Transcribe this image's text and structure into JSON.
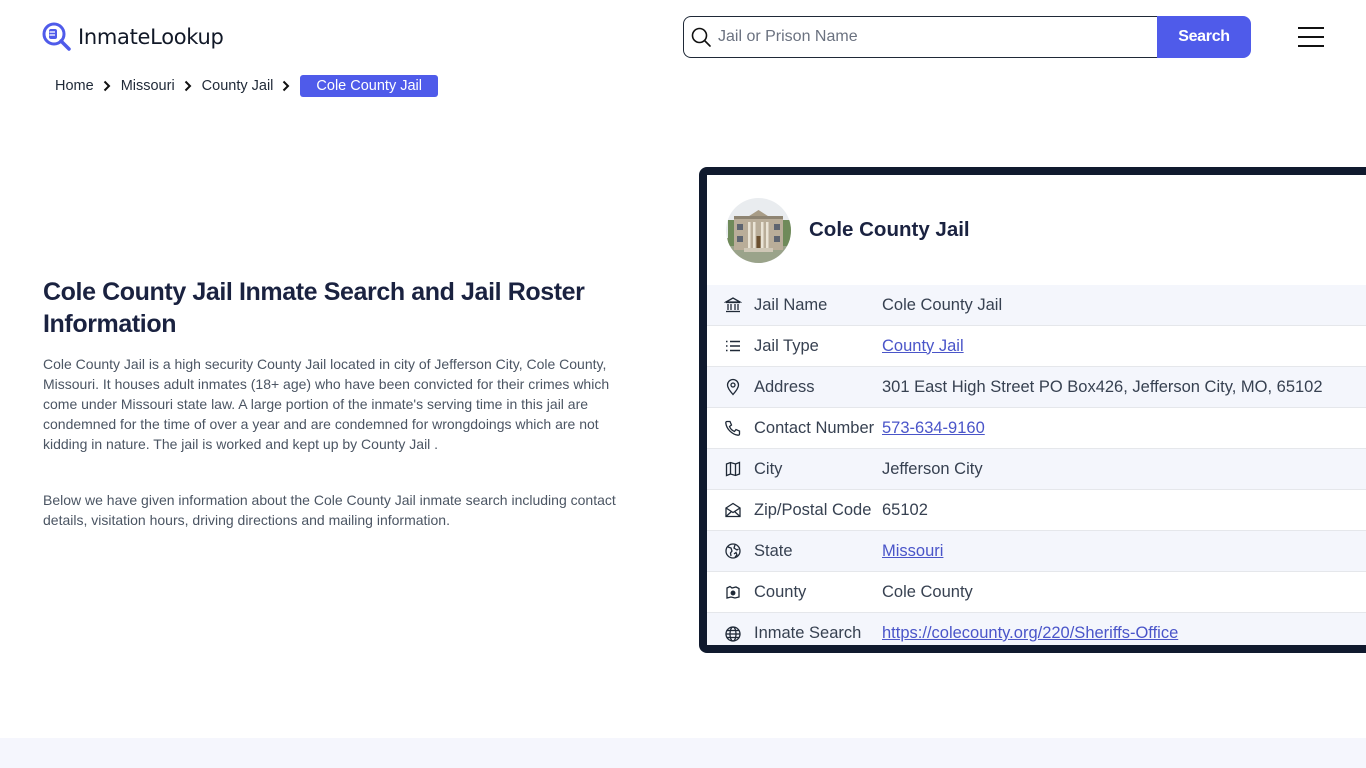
{
  "header": {
    "logo_text": "InmateLookup",
    "search": {
      "placeholder": "Jail or Prison Name",
      "value": "",
      "button_label": "Search"
    },
    "menu_icon": "hamburger-menu-icon"
  },
  "breadcrumb": {
    "items": [
      "Home",
      "Missouri",
      "County Jail"
    ],
    "current": "Cole County Jail"
  },
  "main": {
    "title": "Cole County Jail Inmate Search and Jail Roster Information",
    "paragraphs": [
      "Cole County Jail is a high security County Jail located in city of Jefferson City, Cole County, Missouri. It houses adult inmates (18+ age) who have been convicted for their crimes which come under Missouri state law. A large portion of the inmate's serving time in this jail are condemned for the time of over a year and are condemned for wrongdoings which are not kidding in nature. The jail is worked and kept up by County Jail .",
      "Below we have given information about the Cole County Jail inmate search including contact details, visitation hours, driving directions and mailing information."
    ]
  },
  "card": {
    "title": "Cole County Jail",
    "rows": [
      {
        "icon": "building-columns-icon",
        "label": "Jail Name",
        "value": "Cole County Jail",
        "link": false
      },
      {
        "icon": "list-icon",
        "label": "Jail Type",
        "value": "County Jail",
        "link": true
      },
      {
        "icon": "map-pin-icon",
        "label": "Address",
        "value": "301 East High Street PO Box426, Jefferson City, MO, 65102",
        "link": false
      },
      {
        "icon": "phone-icon",
        "label": "Contact Number",
        "value": "573-634-9160",
        "link": true
      },
      {
        "icon": "map-icon",
        "label": "City",
        "value": "Jefferson City",
        "link": false
      },
      {
        "icon": "mail-open-icon",
        "label": "Zip/Postal Code",
        "value": "65102",
        "link": false
      },
      {
        "icon": "globe-region-icon",
        "label": "State",
        "value": "Missouri",
        "link": true
      },
      {
        "icon": "county-map-icon",
        "label": "County",
        "value": "Cole County",
        "link": false
      },
      {
        "icon": "globe-icon",
        "label": "Inmate Search",
        "value": "https://colecounty.org/220/Sheriffs-Office",
        "link": true
      }
    ]
  },
  "colors": {
    "accent": "#4f5bea",
    "card_border": "#101a2e",
    "link": "#4a55c9",
    "heading": "#1a2240",
    "row_alt": "#f4f6fc"
  }
}
